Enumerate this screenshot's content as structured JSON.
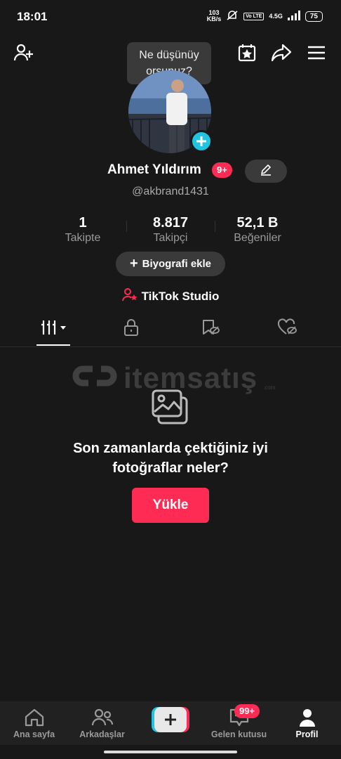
{
  "status_bar": {
    "time": "18:01",
    "net_speed_value": "103",
    "net_speed_unit": "KB/s",
    "volte": "Vo LTE",
    "network": "4.5G",
    "battery": "75"
  },
  "header": {
    "tooltip": "Ne düşünüyorsunuz?",
    "tooltip_line1": "Ne düşünüy",
    "tooltip_line2": "orsunuz?"
  },
  "profile": {
    "name": "Ahmet Yıldırım",
    "badge": "9+",
    "username": "@akbrand1431"
  },
  "stats": [
    {
      "value": "1",
      "label": "Takipte"
    },
    {
      "value": "8.817",
      "label": "Takipçi"
    },
    {
      "value": "52,1 B",
      "label": "Beğeniler"
    }
  ],
  "bio_button": {
    "icon": "+",
    "label": "Biyografi ekle"
  },
  "studio": {
    "label": "TikTok Studio"
  },
  "watermark": {
    "text": "itemsatış",
    "suffix": ".com"
  },
  "empty_state": {
    "line1": "Son zamanlarda çektiğiniz iyi",
    "line2": "fotoğraflar neler?",
    "button": "Yükle"
  },
  "bottom_nav": {
    "home": "Ana sayfa",
    "friends": "Arkadaşlar",
    "create": "+",
    "inbox": "Gelen kutusu",
    "inbox_badge": "99+",
    "profile": "Profil"
  },
  "colors": {
    "accent": "#fe2c55",
    "cyan": "#20c4e0",
    "background": "#181818"
  }
}
